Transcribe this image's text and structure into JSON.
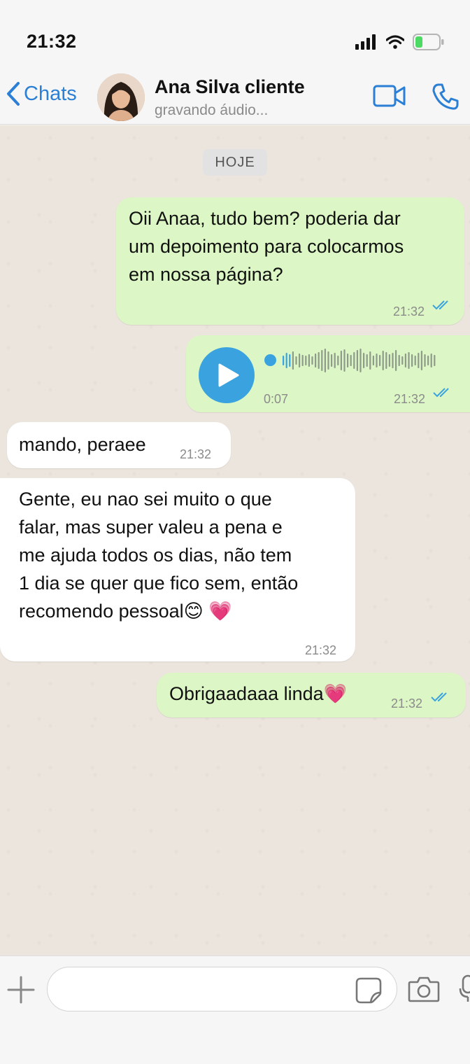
{
  "status_bar": {
    "time": "21:32"
  },
  "header": {
    "back_label": "Chats",
    "contact_name": "Ana Silva cliente",
    "contact_status": "gravando áudio..."
  },
  "chat": {
    "date_label": "HOJE",
    "messages": [
      {
        "direction": "outgoing",
        "text": "Oii Anaa, tudo bem? poderia dar\num depoimento para colocarmos\nem nossa página?",
        "time": "21:32",
        "read": true
      },
      {
        "direction": "outgoing",
        "type": "audio",
        "duration": "0:07",
        "time": "21:32",
        "read": true
      },
      {
        "direction": "incoming",
        "text": "mando, peraee",
        "time": "21:32"
      },
      {
        "direction": "incoming",
        "text": "Gente, eu nao sei muito o que\nfalar, mas super valeu a pena e\nme ajuda todos os dias, não tem\n1 dia se quer que fico sem, então\nrecomendo pessoal😊 💗",
        "time": "21:32"
      },
      {
        "direction": "outgoing",
        "text": "Obrigaadaaa linda💗",
        "time": "21:32",
        "read": true
      }
    ]
  },
  "input": {
    "placeholder": ""
  },
  "colors": {
    "accent": "#2b7fd4",
    "outgoing_bubble": "#dcf7c5",
    "incoming_bubble": "#ffffff",
    "read_ticks": "#3aa3df"
  },
  "icons": [
    "signal-icon",
    "wifi-icon",
    "battery-icon",
    "chevron-left-icon",
    "video-call-icon",
    "phone-icon",
    "play-icon",
    "plus-icon",
    "sticker-icon",
    "camera-icon",
    "mic-icon"
  ]
}
